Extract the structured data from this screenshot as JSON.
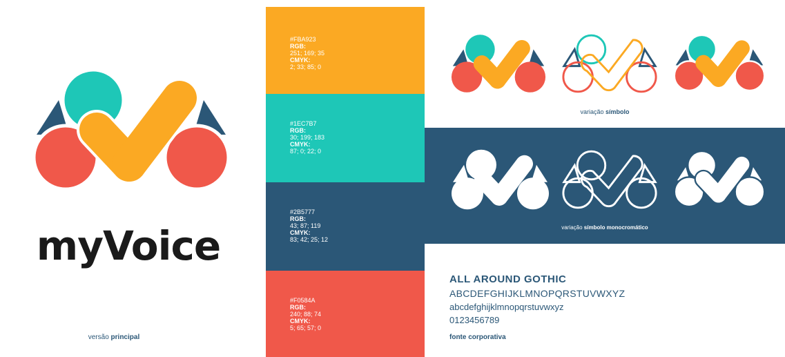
{
  "brand": {
    "wordmark": "myVoice",
    "main_caption_prefix": "versão",
    "main_caption_bold": "principal"
  },
  "palette": [
    {
      "hex": "#FBA923",
      "rgb_label": "RGB:",
      "rgb": "251; 169; 35",
      "cmyk_label": "CMYK:",
      "cmyk": "2; 33; 85; 0"
    },
    {
      "hex": "#1EC7B7",
      "rgb_label": "RGB:",
      "rgb": "30; 199; 183",
      "cmyk_label": "CMYK:",
      "cmyk": "87; 0; 22; 0"
    },
    {
      "hex": "#2B5777",
      "rgb_label": "RGB:",
      "rgb": "43; 87; 119",
      "cmyk_label": "CMYK:",
      "cmyk": "83; 42; 25; 12"
    },
    {
      "hex": "#F0584A",
      "rgb_label": "RGB:",
      "rgb": "240; 88; 74",
      "cmyk_label": "CMYK:",
      "cmyk": "5; 65; 57; 0"
    }
  ],
  "symbol_variation": {
    "prefix": "variação",
    "bold": "símbolo"
  },
  "mono_variation": {
    "prefix": "variação",
    "bold": "símbolo monocromático"
  },
  "typography": {
    "font_name": "ALL AROUND GOTHIC",
    "uppercase": "ABCDEFGHIJKLMNOPQRSTUVWXYZ",
    "lowercase": "abcdefghijklmnopqrstuvwxyz",
    "digits": "0123456789",
    "caption": "fonte corporativa"
  },
  "colors": {
    "orange": "#FBA923",
    "teal": "#1EC7B7",
    "navy": "#2B5777",
    "red": "#F0584A"
  }
}
